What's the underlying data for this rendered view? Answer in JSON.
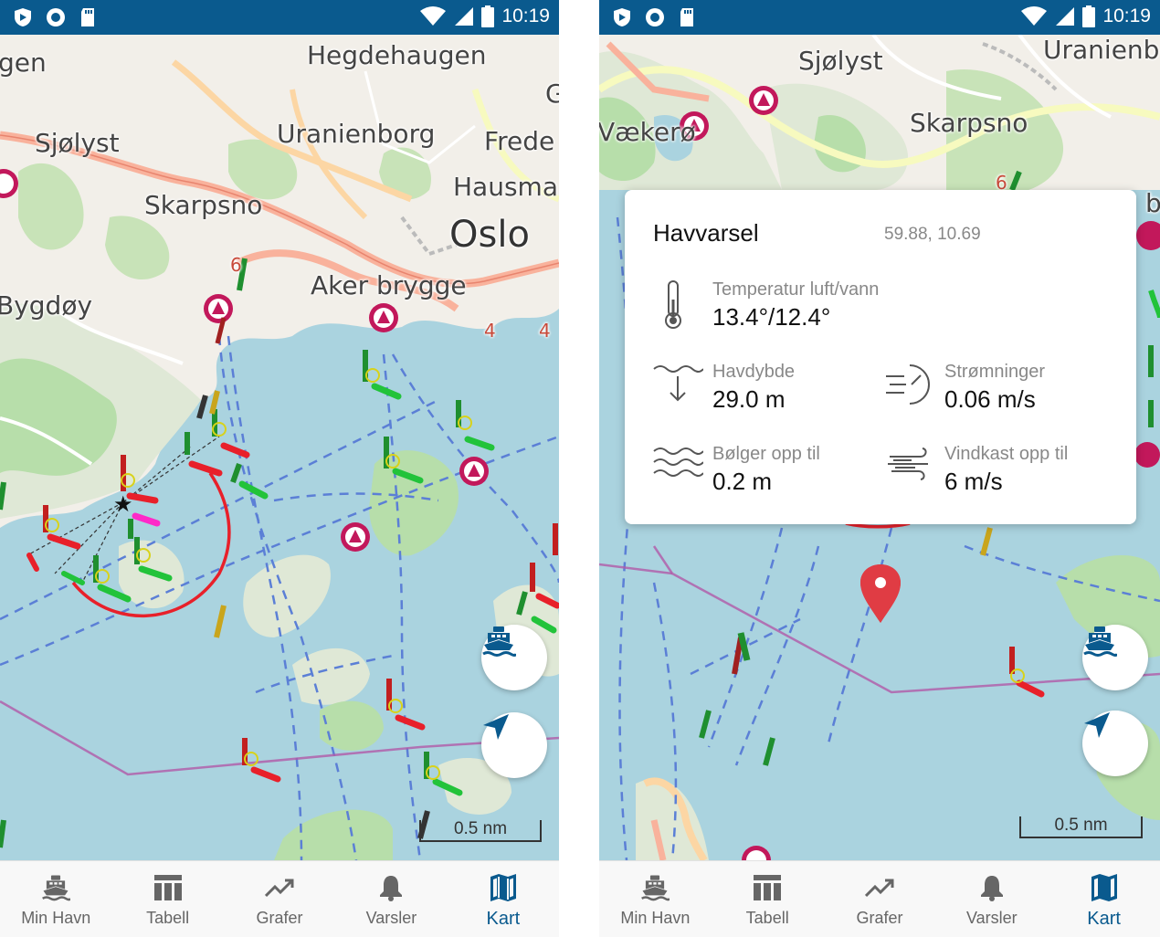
{
  "status_bar": {
    "time": "10:19"
  },
  "left_screen": {
    "map_labels": {
      "hegdehaugen": "Hegdehaugen",
      "uranienborg": "Uranienborg",
      "frede": "Frede",
      "sjolyst": "Sjølyst",
      "skarpsno": "Skarpsno",
      "hausma": "Hausma",
      "oslo": "Oslo",
      "aker_brygge": "Aker brygge",
      "bygdoy": "Bygdøy",
      "gen": "gen",
      "g": "G",
      "road_6": "6",
      "road_4a": "4",
      "road_4b": "4"
    },
    "scale": "0.5 nm"
  },
  "right_screen": {
    "map_labels": {
      "sjolyst": "Sjølyst",
      "uranienb": "Uranienb",
      "skarpsno": "Skarpsno",
      "vaekero": "Vækerø",
      "b": "b",
      "road_6": "6"
    },
    "scale": "0.5 nm",
    "forecast_card": {
      "title": "Havvarsel",
      "coords": "59.88, 10.69",
      "temperature": {
        "label": "Temperatur luft/vann",
        "value": "13.4°/12.4°",
        "icon": "thermometer-icon"
      },
      "depth": {
        "label": "Havdybde",
        "value": "29.0 m",
        "icon": "depth-icon"
      },
      "currents": {
        "label": "Strømninger",
        "value": "0.06 m/s",
        "icon": "current-speed-icon"
      },
      "waves": {
        "label": "Bølger opp til",
        "value": "0.2 m",
        "icon": "waves-icon"
      },
      "gusts": {
        "label": "Vindkast opp til",
        "value": "6 m/s",
        "icon": "wind-icon"
      }
    }
  },
  "bottom_nav": {
    "items": [
      {
        "label": "Min Havn",
        "icon": "ferry-icon"
      },
      {
        "label": "Tabell",
        "icon": "table-icon"
      },
      {
        "label": "Grafer",
        "icon": "trend-icon"
      },
      {
        "label": "Varsler",
        "icon": "bell-icon"
      },
      {
        "label": "Kart",
        "icon": "map-icon"
      }
    ],
    "active": "Kart"
  },
  "colors": {
    "status_bar": "#0a5a8e",
    "accent": "#0a5a8e",
    "water": "#aad3df",
    "land": "#f2efe9",
    "park": "#b7deaa",
    "marker": "#e03c44"
  }
}
